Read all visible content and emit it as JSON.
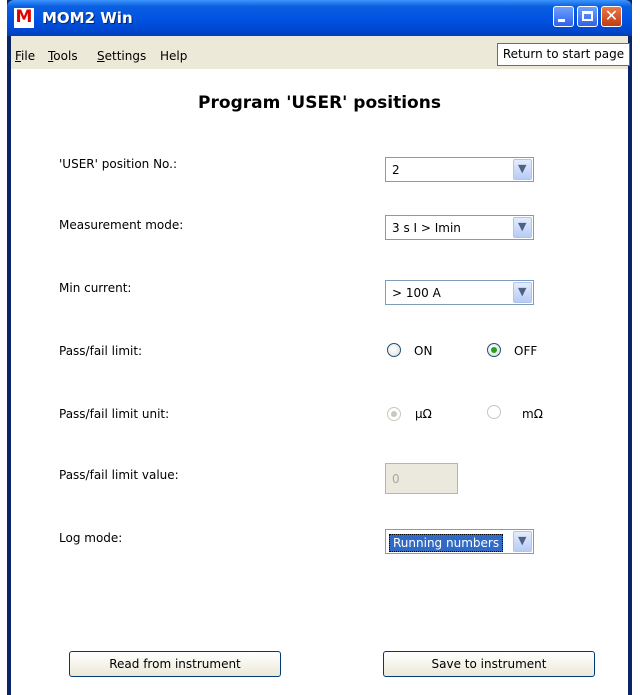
{
  "window": {
    "title": "MOM2 Win",
    "app_icon_letter": "M"
  },
  "titlebar_buttons": {
    "minimize_icon": "minimize-icon",
    "maximize_icon": "maximize-icon",
    "close_glyph": "✕"
  },
  "menu": {
    "items": [
      {
        "label": "File",
        "mnemonic": "F"
      },
      {
        "label": "Tools",
        "mnemonic": "T"
      },
      {
        "label": "Settings",
        "mnemonic": "S"
      },
      {
        "label": "Help",
        "mnemonic": ""
      }
    ],
    "return_label": "Return to start page"
  },
  "page": {
    "title": "Program 'USER' positions",
    "fields": {
      "user_position": {
        "label": "'USER' position No.:",
        "value": "2"
      },
      "measurement_mode": {
        "label": "Measurement mode:",
        "value": "3  s I > Imin"
      },
      "min_current": {
        "label": "Min current:",
        "value": "> 100 A"
      },
      "pass_fail_limit": {
        "label": "Pass/fail limit:",
        "options": [
          "ON",
          "OFF"
        ],
        "selected": "OFF"
      },
      "pass_fail_unit": {
        "label": "Pass/fail limit unit:",
        "options": [
          "μΩ",
          "mΩ"
        ],
        "selected": "μΩ",
        "enabled": false
      },
      "pass_fail_value": {
        "label": "Pass/fail limit value:",
        "value": "0",
        "enabled": false
      },
      "log_mode": {
        "label": "Log mode:",
        "value": "Running numbers"
      }
    },
    "buttons": {
      "read": "Read from instrument",
      "save": "Save to instrument"
    }
  }
}
